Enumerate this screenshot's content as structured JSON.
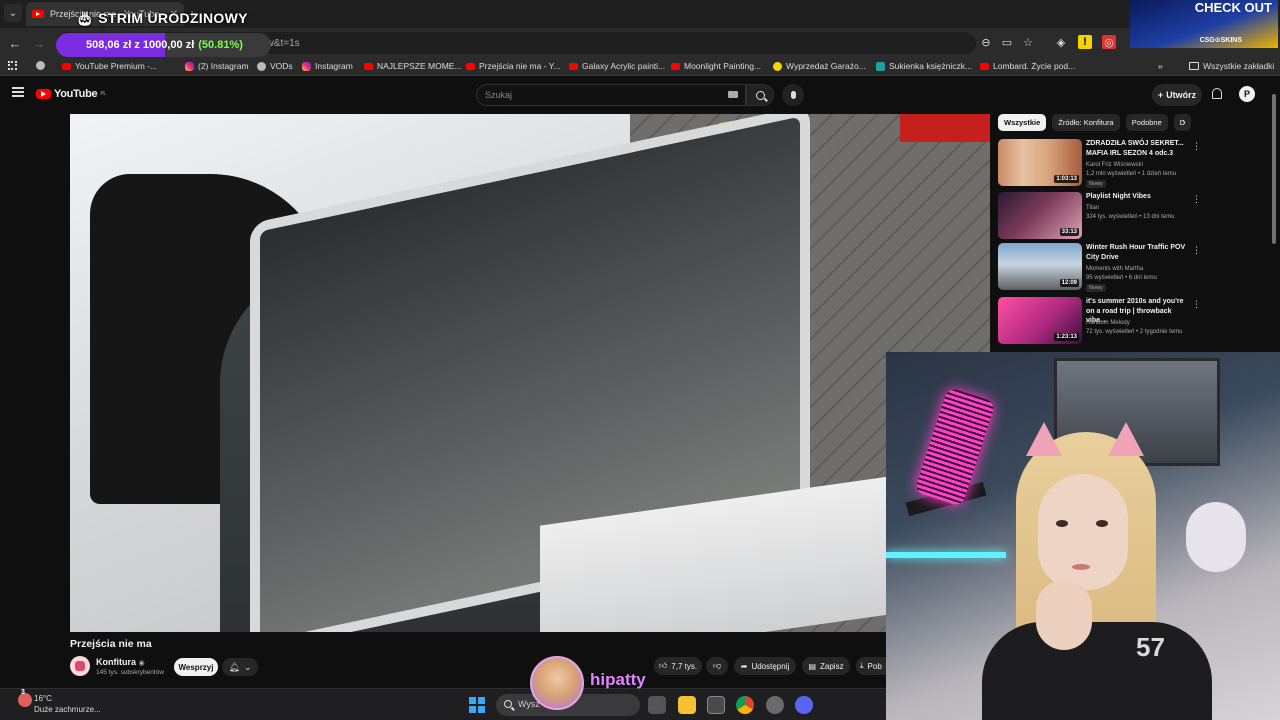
{
  "overlay": {
    "title": "STRIM URODZINOWY",
    "donation_text": "508,06 zł z 1000,00 zł",
    "donation_percent_label": "(50.81%)",
    "donation_progress": 0.5081,
    "csgo_banner_cta": "CHECK OUT",
    "csgo_banner_brand": "CSG⊙SKINS",
    "streamer_handle": "hipatty"
  },
  "browser": {
    "tab_title": "Przejścia nie ma - YouTube",
    "url_visible": "/law&t=1s",
    "bookmarks": [
      {
        "label": "YouTube Premium -...",
        "icon": "youtube-icon"
      },
      {
        "label": "(2) Instagram",
        "icon": "instagram-icon"
      },
      {
        "label": "VODs",
        "icon": "globe-icon"
      },
      {
        "label": "Instagram",
        "icon": "instagram-icon"
      },
      {
        "label": "NAJLEPSZE MOME...",
        "icon": "youtube-icon"
      },
      {
        "label": "Przejścia nie ma - Y...",
        "icon": "youtube-icon"
      },
      {
        "label": "Galaxy Acrylic painti...",
        "icon": "youtube-icon"
      },
      {
        "label": "Moonlight Painting...",
        "icon": "youtube-icon"
      },
      {
        "label": "Wyprzedaż Garażo...",
        "icon": "yellow-dot-icon"
      },
      {
        "label": "Sukienka księżniczk...",
        "icon": "v-icon"
      },
      {
        "label": "Lombard. Życie pod...",
        "icon": "youtube-icon"
      }
    ],
    "all_bookmarks_label": "Wszystkie zakładki"
  },
  "youtube": {
    "logo_text": "YouTube",
    "region": "PL",
    "search_placeholder": "Szukaj",
    "create_label": "Utwórz",
    "avatar_letter": "P"
  },
  "video": {
    "title": "Przejścia nie ma",
    "channel_name": "Konfitura",
    "subscribers": "145 tys. subskrybentów",
    "support_label": "Wesprzyj",
    "likes": "7,7 tys.",
    "share_label": "Udostępnij",
    "save_label": "Zapisz",
    "download_label": "Pob"
  },
  "sidebar": {
    "chips": [
      "Wszystkie",
      "Źródło: Konfitura",
      "Podobne",
      "D"
    ],
    "recommendations": [
      {
        "title": "ZDRADZIŁA SWÓJ SEKRET... MAFIA IRL SEZON 4 odc.3",
        "channel": "Karol Friz Wiśniewski",
        "meta": "1,2 mln wyświetleń • 1 dzień temu",
        "badge": "Nowy",
        "duration": "1:03:13"
      },
      {
        "title": "Playlist Night Vibes",
        "channel": "Titan",
        "meta": "324 tys. wyświetleń • 13 dni temu",
        "badge": "",
        "duration": "33:13"
      },
      {
        "title": "Winter Rush Hour Traffic POV City Drive",
        "channel": "Moments with Martha",
        "meta": "95 wyświetleń • 6 dni temu",
        "badge": "Nowy",
        "duration": "12:09"
      },
      {
        "title": "it's summer 2010s and you're on a road trip | throwback vibe...",
        "channel": "Random Melody",
        "meta": "72 tys. wyświetleń • 2 tygodnie temu",
        "badge": "",
        "duration": "1:23:13"
      }
    ]
  },
  "taskbar": {
    "weather_temp": "16°C",
    "weather_desc": "Duże zachmurze...",
    "weather_badge": "3",
    "search_label": "Wysz"
  },
  "colors": {
    "youtube_red": "#ff0000",
    "donation_purple": "#7a2de0",
    "donation_green": "#7cff4e",
    "hipatty_pink": "#e084ff"
  }
}
